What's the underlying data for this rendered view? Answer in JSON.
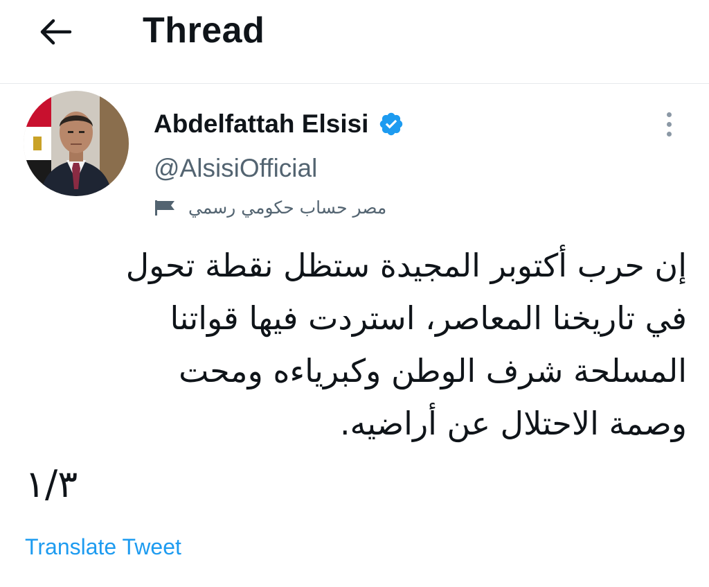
{
  "header": {
    "back_icon": "arrow-left-icon",
    "title": "Thread"
  },
  "tweet": {
    "author": {
      "display_name": "Abdelfattah Elsisi",
      "handle": "@AlsisiOfficial",
      "verified": true,
      "verified_icon": "verified-badge-icon",
      "avatar_icon": "profile-photo"
    },
    "account_label": {
      "icon": "flag-icon",
      "text": "مصر حساب حكومي رسمي"
    },
    "more_icon": "more-vertical-icon",
    "text_lines": [
      "إن حرب أكتوبر المجيدة ستظل نقطة تحول",
      "في تاريخنا المعاصر، استردت فيها قواتنا",
      "المسلحة شرف الوطن وكبرياءه ومحت",
      "وصمة الاحتلال عن أراضيه."
    ],
    "thread_counter": "١/٣",
    "translate_label": "Translate Tweet"
  },
  "colors": {
    "accent": "#1d9bf0",
    "text_primary": "#0f1419",
    "text_secondary": "#536471",
    "divider": "#e6e9ec"
  }
}
